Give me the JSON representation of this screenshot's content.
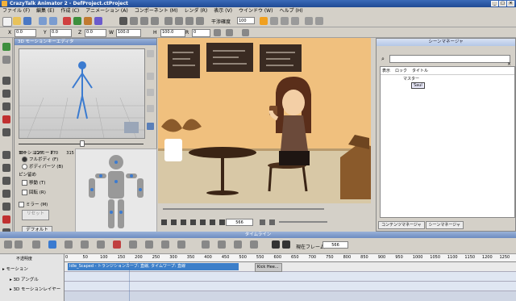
{
  "app": {
    "title": "CrazyTalk Animator 2 - DefProject.ctProject",
    "window_controls": [
      "_",
      "□",
      "×"
    ]
  },
  "menu": [
    "ファイル (F)",
    "編集 (E)",
    "作成 (C)",
    "アニメーション (A)",
    "コンポーネント (M)",
    "レンダ (R)",
    "表示 (V)",
    "ウインドウ (W)",
    "ヘルプ (H)"
  ],
  "toolbar": {
    "frame_rate_label": "干渉確度",
    "frame_rate_value": "100"
  },
  "transform": {
    "x_label": "X",
    "x_value": "0.0",
    "y_label": "Y",
    "y_value": "0.0",
    "z_label": "Z",
    "z_value": "0.0",
    "w_label": "W",
    "w_value": "100.0",
    "h_label": "H",
    "h_value": "100.0",
    "r_label": "R",
    "r_value": "0"
  },
  "motion_panel": {
    "title": "3D モーションキーエディタ",
    "scale_ticks": [
      "180",
      "225",
      "270",
      "315",
      "0",
      "45",
      "90",
      "135",
      "180"
    ],
    "mode_label": "モーションモード",
    "mode_full": "フルボディ (F)",
    "mode_part": "ボディパーツ (B)",
    "pin_label": "ピン留め",
    "pin_move": "移動 (T)",
    "pin_rotate": "回転 (R)",
    "mirror_label": "ミラー (M)",
    "reset_button": "リセット",
    "default_button": "デフォルト"
  },
  "playbar": {
    "current_frame": "566"
  },
  "scene_manager": {
    "title": "シーンマネージャ",
    "columns": [
      "表示",
      "ロック",
      "タイトル"
    ],
    "rows": [
      {
        "title": "マスター"
      },
      {
        "title": "Saul"
      }
    ],
    "tabs": [
      "コンテンツマネージャ",
      "シーンマネージャ"
    ]
  },
  "timeline": {
    "title": "タイムライン",
    "current_frame_label": "現在フレーム:",
    "current_frame": "566",
    "ruler_label": "不透明度",
    "ruler": [
      "0",
      "50",
      "100",
      "150",
      "200",
      "250",
      "300",
      "350",
      "400",
      "450",
      "500",
      "550",
      "600",
      "650",
      "700",
      "750",
      "800",
      "850",
      "900",
      "950",
      "1000",
      "1050",
      "1100",
      "1150",
      "1200",
      "1250"
    ],
    "tracks": [
      {
        "label": "モーション",
        "clip1": "Idle_Scaped - トランジションカーブ: 直線, タイムワープ: 直線",
        "clip2": "Kick Hee..."
      },
      {
        "label": "3D アングル"
      },
      {
        "label": "3D モーションレイヤー"
      }
    ]
  },
  "colors": {
    "accent": "#3d7fc9",
    "scene_wall": "#f0c07e",
    "scene_floor": "#d8c8a6"
  }
}
